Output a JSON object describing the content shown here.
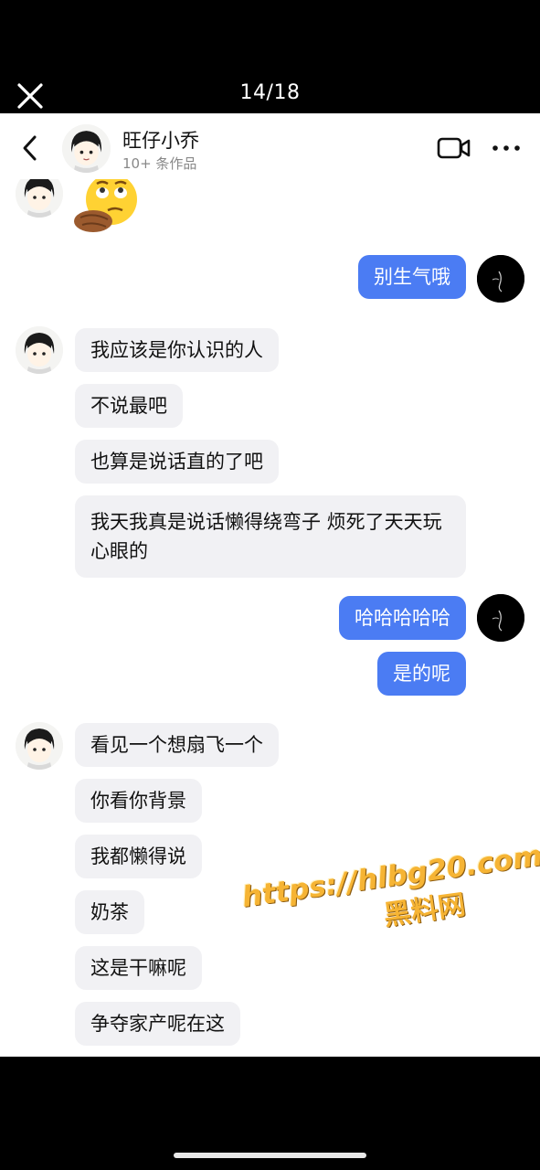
{
  "viewer": {
    "counter": "14/18"
  },
  "header": {
    "name": "旺仔小乔",
    "subtitle": "10+ 条作品"
  },
  "messages": {
    "m1": "别生气哦",
    "m2": "我应该是你认识的人",
    "m3": "不说最吧",
    "m4": "也算是说话直的了吧",
    "m5": "我天我真是说话懒得绕弯子 烦死了天天玩心眼的",
    "m6": "哈哈哈哈哈",
    "m7": "是的呢",
    "m8": "看见一个想扇飞一个",
    "m9": "你看你背景",
    "m10": "我都懒得说",
    "m11": "奶茶",
    "m12": "这是干嘛呢",
    "m13": "争夺家产呢在这"
  },
  "watermark": {
    "url": "https://hlbg20.com",
    "name": "黑料网"
  },
  "colors": {
    "outgoing_bubble": "#4b7cf3",
    "incoming_bubble": "#f1f1f4",
    "watermark": "#f6b434"
  },
  "icons": [
    "close-icon",
    "back-icon",
    "video-call-icon",
    "more-icon"
  ]
}
